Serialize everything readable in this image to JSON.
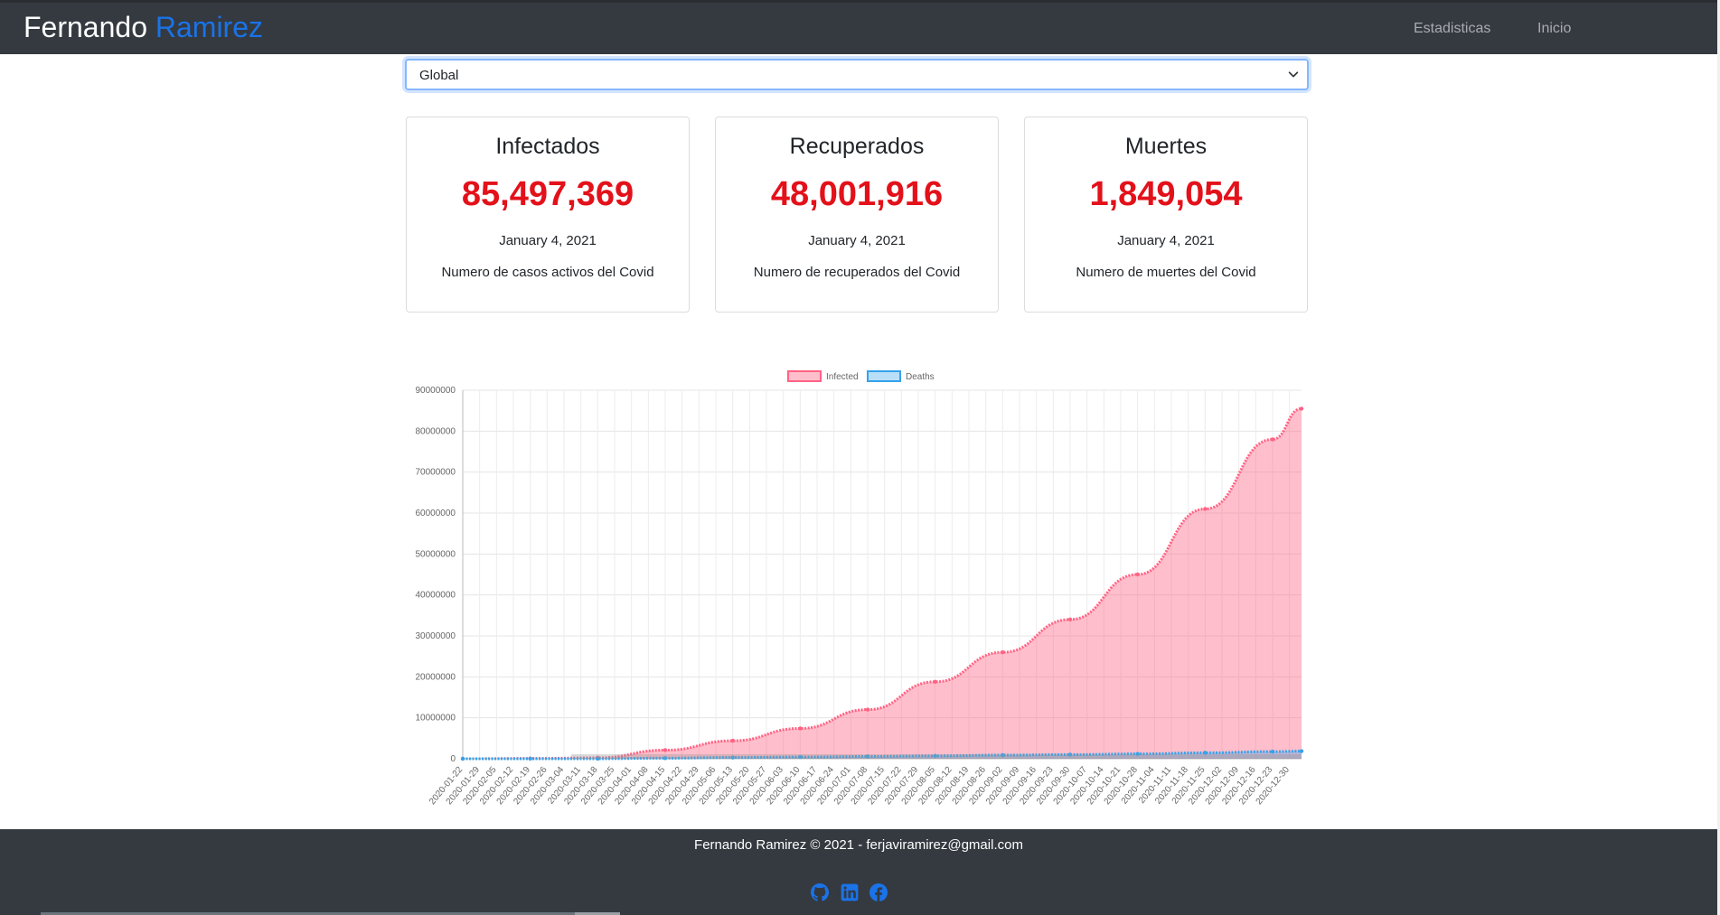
{
  "nav": {
    "brand_first": "Fernando",
    "brand_last": "Ramirez",
    "links": [
      "Estadisticas",
      "Inicio"
    ]
  },
  "filter": {
    "selected": "Global"
  },
  "cards": [
    {
      "title": "Infectados",
      "value": "85,497,369",
      "date": "January 4, 2021",
      "desc": "Numero de casos activos del Covid"
    },
    {
      "title": "Recuperados",
      "value": "48,001,916",
      "date": "January 4, 2021",
      "desc": "Numero de recuperados del Covid"
    },
    {
      "title": "Muertes",
      "value": "1,849,054",
      "date": "January 4, 2021",
      "desc": "Numero de muertes del Covid"
    }
  ],
  "chart_data": {
    "type": "area",
    "ylim": [
      0,
      90000000
    ],
    "y_ticks": [
      "0",
      "10000000",
      "20000000",
      "30000000",
      "40000000",
      "50000000",
      "60000000",
      "70000000",
      "80000000",
      "90000000"
    ],
    "grid": true,
    "legend_position": "top",
    "x_tick_labels": [
      "2020-01-22",
      "2020-01-29",
      "2020-02-05",
      "2020-02-12",
      "2020-02-19",
      "2020-02-26",
      "2020-03-04",
      "2020-03-11",
      "2020-03-18",
      "2020-03-25",
      "2020-04-01",
      "2020-04-08",
      "2020-04-15",
      "2020-04-22",
      "2020-04-29",
      "2020-05-06",
      "2020-05-13",
      "2020-05-20",
      "2020-05-27",
      "2020-06-03",
      "2020-06-10",
      "2020-06-17",
      "2020-06-24",
      "2020-07-01",
      "2020-07-08",
      "2020-07-15",
      "2020-07-22",
      "2020-07-29",
      "2020-08-05",
      "2020-08-12",
      "2020-08-19",
      "2020-08-26",
      "2020-09-02",
      "2020-09-09",
      "2020-09-16",
      "2020-09-23",
      "2020-09-30",
      "2020-10-07",
      "2020-10-14",
      "2020-10-21",
      "2020-10-28",
      "2020-11-04",
      "2020-11-11",
      "2020-11-18",
      "2020-11-25",
      "2020-12-02",
      "2020-12-09",
      "2020-12-16",
      "2020-12-23",
      "2020-12-30"
    ],
    "x": [
      "2020-01-22",
      "2020-02-19",
      "2020-03-18",
      "2020-04-15",
      "2020-05-13",
      "2020-06-10",
      "2020-07-08",
      "2020-08-05",
      "2020-09-02",
      "2020-09-30",
      "2020-10-28",
      "2020-11-25",
      "2020-12-23",
      "2021-01-04"
    ],
    "series": [
      {
        "name": "Infected",
        "color": "#ff6384",
        "values": [
          600,
          76000,
          220000,
          2100000,
          4400000,
          7400000,
          12000000,
          18800000,
          26000000,
          34000000,
          45000000,
          61000000,
          78000000,
          85497369
        ]
      },
      {
        "name": "Deaths",
        "color": "#36a2eb",
        "values": [
          17,
          2250,
          8800,
          140000,
          300000,
          420000,
          550000,
          700000,
          880000,
          1000000,
          1180000,
          1450000,
          1740000,
          1849054
        ]
      }
    ]
  },
  "footer": {
    "text": "Fernando Ramirez © 2021 - ferjaviramirez@gmail.com",
    "icons": [
      "github-icon",
      "linkedin-icon",
      "facebook-icon"
    ],
    "icon_color": "#1a73e8"
  }
}
